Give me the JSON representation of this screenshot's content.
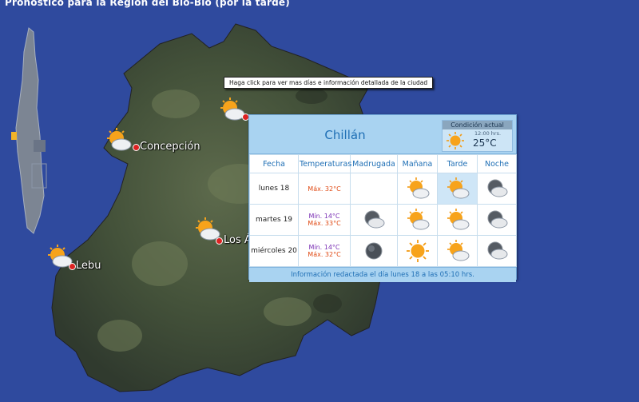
{
  "page": {
    "title": "Pronóstico para la Región del Bío-Bío (por la tarde)"
  },
  "tooltip": {
    "text": "Haga click para ver mas días e información detallada de la ciudad"
  },
  "cities": {
    "concepcion": "Concepción",
    "chillan": "Chillán",
    "los_angeles": "Los Á",
    "lebu": "Lebu"
  },
  "panel": {
    "city": "Chillán",
    "current": {
      "title": "Condición actual",
      "time": "12:00 hrs.",
      "temp": "25°C",
      "icon": "sun-icon"
    },
    "headers": [
      "Fecha",
      "Temperaturas",
      "Madrugada",
      "Mañana",
      "Tarde",
      "Noche"
    ],
    "rows": [
      {
        "date": "lunes 18",
        "min": "",
        "max": "Máx. 32°C",
        "icons": [
          "",
          "partly-cloudy-icon",
          "partly-cloudy-icon",
          "night-cloudy-icon"
        ]
      },
      {
        "date": "martes 19",
        "min": "Mín. 14°C",
        "max": "Máx. 33°C",
        "icons": [
          "night-cloudy-icon",
          "partly-cloudy-icon",
          "partly-cloudy-icon",
          "night-cloudy-icon"
        ]
      },
      {
        "date": "miércoles 20",
        "min": "Mín. 14°C",
        "max": "Máx. 32°C",
        "icons": [
          "night-clear-icon",
          "sun-icon",
          "partly-cloudy-icon",
          "night-cloudy-icon"
        ]
      }
    ],
    "footer": "Información redactada el día lunes 18 a las 05:10 hrs."
  },
  "colors": {
    "background": "#2f4a9e",
    "panel_header": "#a9d3f1",
    "accent_text": "#1f6fb5",
    "max_temp": "#e04a14",
    "min_temp": "#7a2fb4"
  }
}
